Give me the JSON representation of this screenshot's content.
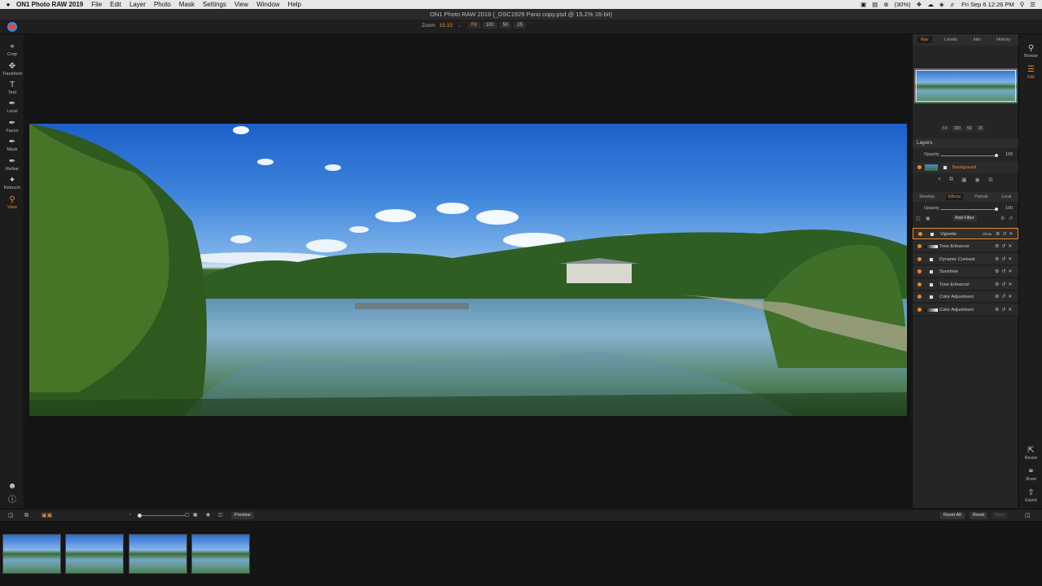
{
  "menubar": {
    "app": "ON1 Photo RAW 2019",
    "items": [
      "File",
      "Edit",
      "Layer",
      "Photo",
      "Mask",
      "Settings",
      "View",
      "Window",
      "Help"
    ],
    "battery": "(30%)",
    "datetime": "Fri Sep 6  12:26 PM"
  },
  "window": {
    "title": "ON1 Photo RAW 2019 (_DSC1929 Pano copy.psd @ 15.2% 16-bit)"
  },
  "toolbar": {
    "zoom_label": "Zoom",
    "zoom_value": "15.15",
    "zoom_buttons": [
      "Fit",
      "100",
      "50",
      "25"
    ]
  },
  "tools": [
    "Crop",
    "Transform",
    "Text",
    "Local",
    "Faces",
    "Mask",
    "Refine",
    "Retouch",
    "View"
  ],
  "nav_panel": {
    "tabs": [
      "Nav",
      "Levels",
      "Info",
      "History"
    ],
    "zoom_buttons": [
      "Fit",
      "100",
      "50",
      "25"
    ]
  },
  "layers": {
    "header": "Layers",
    "opacity_label": "Opacity",
    "opacity_value": "100",
    "opacity": 1.0,
    "layer_name": "Background"
  },
  "effects": {
    "tabs": [
      "Develop",
      "Effects",
      "Portrait",
      "Local"
    ],
    "opacity_label": "Opacity",
    "opacity_value": "100",
    "opacity": 1.0,
    "add_filter_label": "Add Filter",
    "show_label": "Show",
    "filters": [
      "Vignette",
      "Tone Enhancer",
      "Dynamic Contrast",
      "Sunshine",
      "Tone Enhancer",
      "Color Adjustment",
      "Color Adjustment"
    ]
  },
  "modules": {
    "top": [
      "Browse",
      "Edit"
    ],
    "bottom": [
      "Resize",
      "Share",
      "Export"
    ]
  },
  "bottombar": {
    "preview_label": "Preview",
    "reset_all_label": "Reset All",
    "reset_label": "Reset",
    "sync_label": "Sync"
  }
}
